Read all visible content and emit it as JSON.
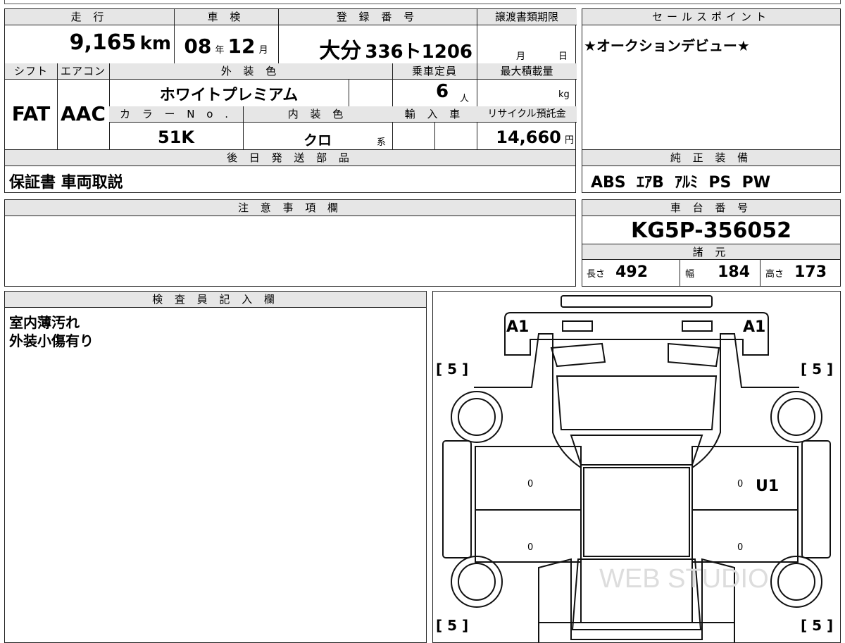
{
  "sheet": {
    "mileage_label": "走 行",
    "mileage_value": "9,165",
    "mileage_unit": "km",
    "inspection_label": "車 検",
    "inspection_year": "08",
    "inspection_year_unit": "年",
    "inspection_month": "12",
    "inspection_month_unit": "月",
    "registration_label": "登 録 番 号",
    "registration_region": "大分",
    "registration_number": "336ト1206",
    "transfer_label": "譲渡書類期限",
    "transfer_month_unit": "月",
    "transfer_day_unit": "日",
    "shift_label": "シフト",
    "shift_value": "FAT",
    "ac_label": "エアコン",
    "ac_value": "AAC",
    "exterior_label": "外 装 色",
    "exterior_value": "ホワイトプレミアム",
    "capacity_label": "乗車定員",
    "capacity_value": "6",
    "capacity_unit": "人",
    "load_label": "最大積載量",
    "load_unit": "kg",
    "color_no_label": "カ ラ ー N o .",
    "color_no_value": "51K",
    "interior_label": "内 装 色",
    "interior_value": "クロ",
    "interior_unit": "系",
    "import_label": "輸 入 車",
    "recycle_label": "リサイクル預託金",
    "recycle_value": "14,660",
    "recycle_unit": "円",
    "later_parts_label": "後 日 発 送 部 品",
    "later_parts_value": "保証書 車両取説",
    "notes_label": "注 意 事 項 欄",
    "inspector_label": "検 査 員 記 入 欄",
    "inspector_line1": "室内薄汚れ",
    "inspector_line2": "外装小傷有り"
  },
  "sales": {
    "label": "セールスポイント",
    "text": "★オークションデビュー★"
  },
  "equipment": {
    "label": "純 正 装 備",
    "value": "ABS  ｴｱB  ｱﾙﾐ  PS  PW"
  },
  "chassis": {
    "label": "車 台 番 号",
    "value": "KG5P-356052",
    "spec_label": "諸 元",
    "length_label": "長さ",
    "length_value": "492",
    "width_label": "幅",
    "width_value": "184",
    "height_label": "高さ",
    "height_value": "173"
  },
  "diagram": {
    "mark_front_left": "A1",
    "mark_front_right": "A1",
    "tire_fl": "[ 5 ]",
    "tire_fr": "[ 5 ]",
    "tire_rl": "[ 5 ]",
    "tire_rr": "[ 5 ]",
    "mark_right_door": "U1",
    "zero1": "0",
    "zero2": "0",
    "zero3": "0",
    "zero4": "0",
    "watermark": "WEB STUDIO"
  }
}
